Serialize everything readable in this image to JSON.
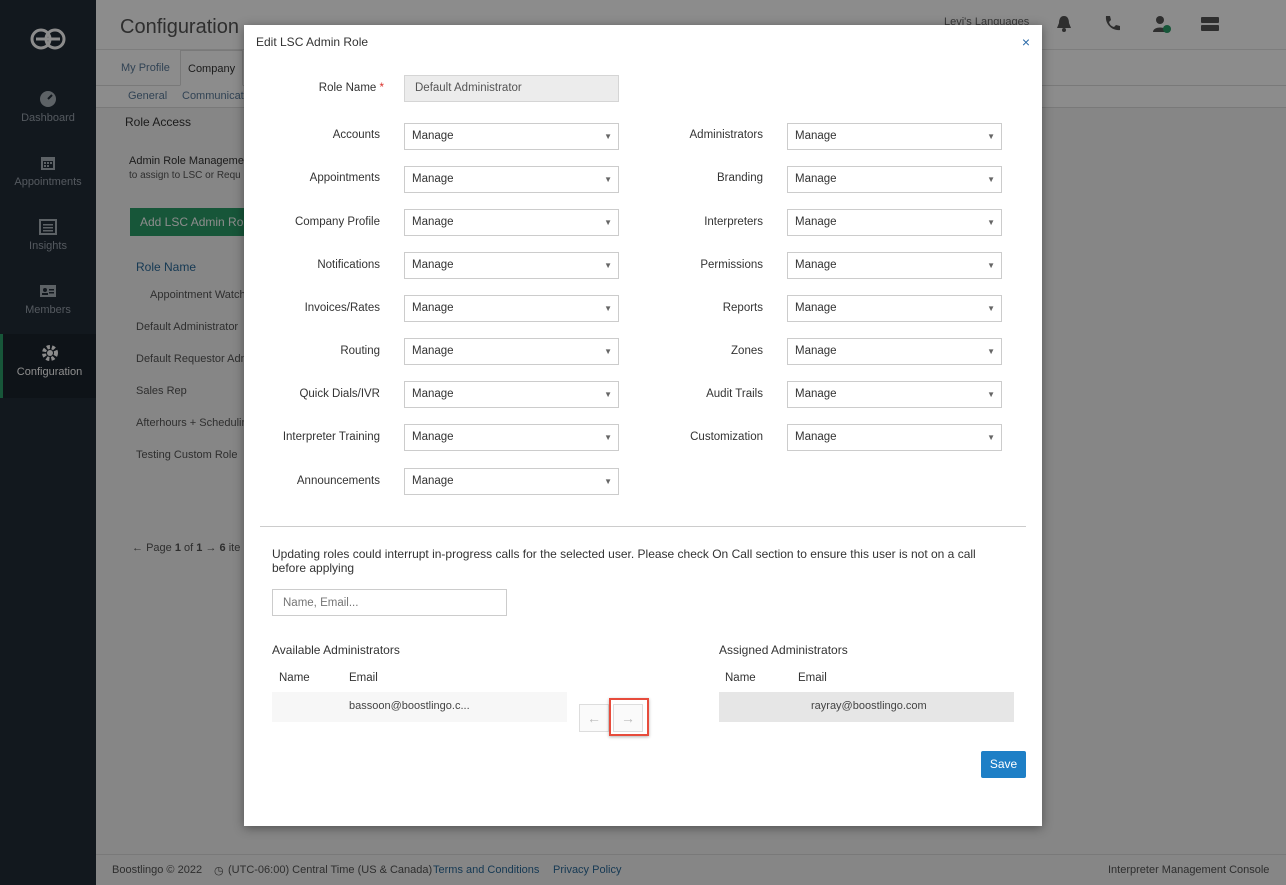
{
  "sidebar": {
    "items": [
      {
        "label": "Dashboard",
        "icon": "dashboard-icon"
      },
      {
        "label": "Appointments",
        "icon": "calendar-icon"
      },
      {
        "label": "Insights",
        "icon": "list-icon"
      },
      {
        "label": "Members",
        "icon": "id-card-icon"
      },
      {
        "label": "Configuration",
        "icon": "gear-icon",
        "active": true
      }
    ]
  },
  "header": {
    "title": "Configuration",
    "org": "Levi's Languages"
  },
  "tabs": [
    "My Profile",
    "Company"
  ],
  "subtabs": [
    "General",
    "Communicat"
  ],
  "background": {
    "section": "Role Access",
    "admin_mgmt": "Admin Role Managemer",
    "admin_mgmt_sub": "to assign to LSC or Requ",
    "add_button": "Add LSC Admin Ro",
    "role_header": "Role Name",
    "roles": [
      "Appointment Watch",
      "Default Administrator",
      "Default Requestor Adm",
      "Sales Rep",
      "Afterhours + Schedulin",
      "Testing Custom Role"
    ],
    "pager_prefix": "Page",
    "pager_current": "1",
    "pager_of": "of",
    "pager_total": "1",
    "pager_items_count": "6",
    "pager_items_word": "ite"
  },
  "modal": {
    "title": "Edit LSC Admin Role",
    "close": "×",
    "role_name_label": "Role Name",
    "role_name_value": "Default Administrator",
    "left_permissions": [
      {
        "label": "Accounts",
        "value": "Manage"
      },
      {
        "label": "Appointments",
        "value": "Manage"
      },
      {
        "label": "Company Profile",
        "value": "Manage"
      },
      {
        "label": "Notifications",
        "value": "Manage"
      },
      {
        "label": "Invoices/Rates",
        "value": "Manage"
      },
      {
        "label": "Routing",
        "value": "Manage"
      },
      {
        "label": "Quick Dials/IVR",
        "value": "Manage"
      },
      {
        "label": "Interpreter Training",
        "value": "Manage"
      },
      {
        "label": "Announcements",
        "value": "Manage"
      }
    ],
    "right_permissions": [
      {
        "label": "Administrators",
        "value": "Manage"
      },
      {
        "label": "Branding",
        "value": "Manage"
      },
      {
        "label": "Interpreters",
        "value": "Manage"
      },
      {
        "label": "Permissions",
        "value": "Manage"
      },
      {
        "label": "Reports",
        "value": "Manage"
      },
      {
        "label": "Zones",
        "value": "Manage"
      },
      {
        "label": "Audit Trails",
        "value": "Manage"
      },
      {
        "label": "Customization",
        "value": "Manage"
      }
    ],
    "warning": "Updating roles could interrupt in-progress calls for the selected user. Please check On Call section to ensure this user is not on a call before applying",
    "search_placeholder": "Name, Email...",
    "available": {
      "title": "Available Administrators",
      "columns": [
        "Name",
        "Email"
      ],
      "rows": [
        {
          "name": "",
          "email": "bassoon@boostlingo.c..."
        }
      ]
    },
    "assigned": {
      "title": "Assigned Administrators",
      "columns": [
        "Name",
        "Email"
      ],
      "rows": [
        {
          "name": "",
          "email": "rayray@boostlingo.com"
        }
      ]
    },
    "move_left": "←",
    "move_right": "→",
    "save": "Save"
  },
  "footer": {
    "brand": "Boostlingo © 2022",
    "timezone": "(UTC-06:00) Central Time (US & Canada)",
    "terms": "Terms and Conditions",
    "privacy": "Privacy Policy",
    "product": "Interpreter Management Console"
  }
}
